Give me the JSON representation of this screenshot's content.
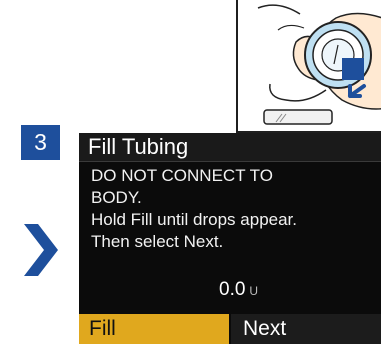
{
  "step": {
    "number": "3"
  },
  "screen": {
    "title": "Fill Tubing",
    "lines": [
      "DO NOT CONNECT TO",
      "BODY.",
      "Hold Fill until drops appear.",
      "Then select Next."
    ],
    "amount_value": "0.0",
    "amount_unit": "U"
  },
  "buttons": {
    "fill_label": "Fill",
    "next_label": "Next"
  },
  "icons": {
    "step_advance": "chevron-right-icon",
    "illustration_pointer": "arrow-icon"
  },
  "colors": {
    "step_badge": "#1e4f9c",
    "fill_button": "#e0a81e",
    "screen_background": "#0b0b0b",
    "illustration_accent": "#1e4f9c"
  }
}
